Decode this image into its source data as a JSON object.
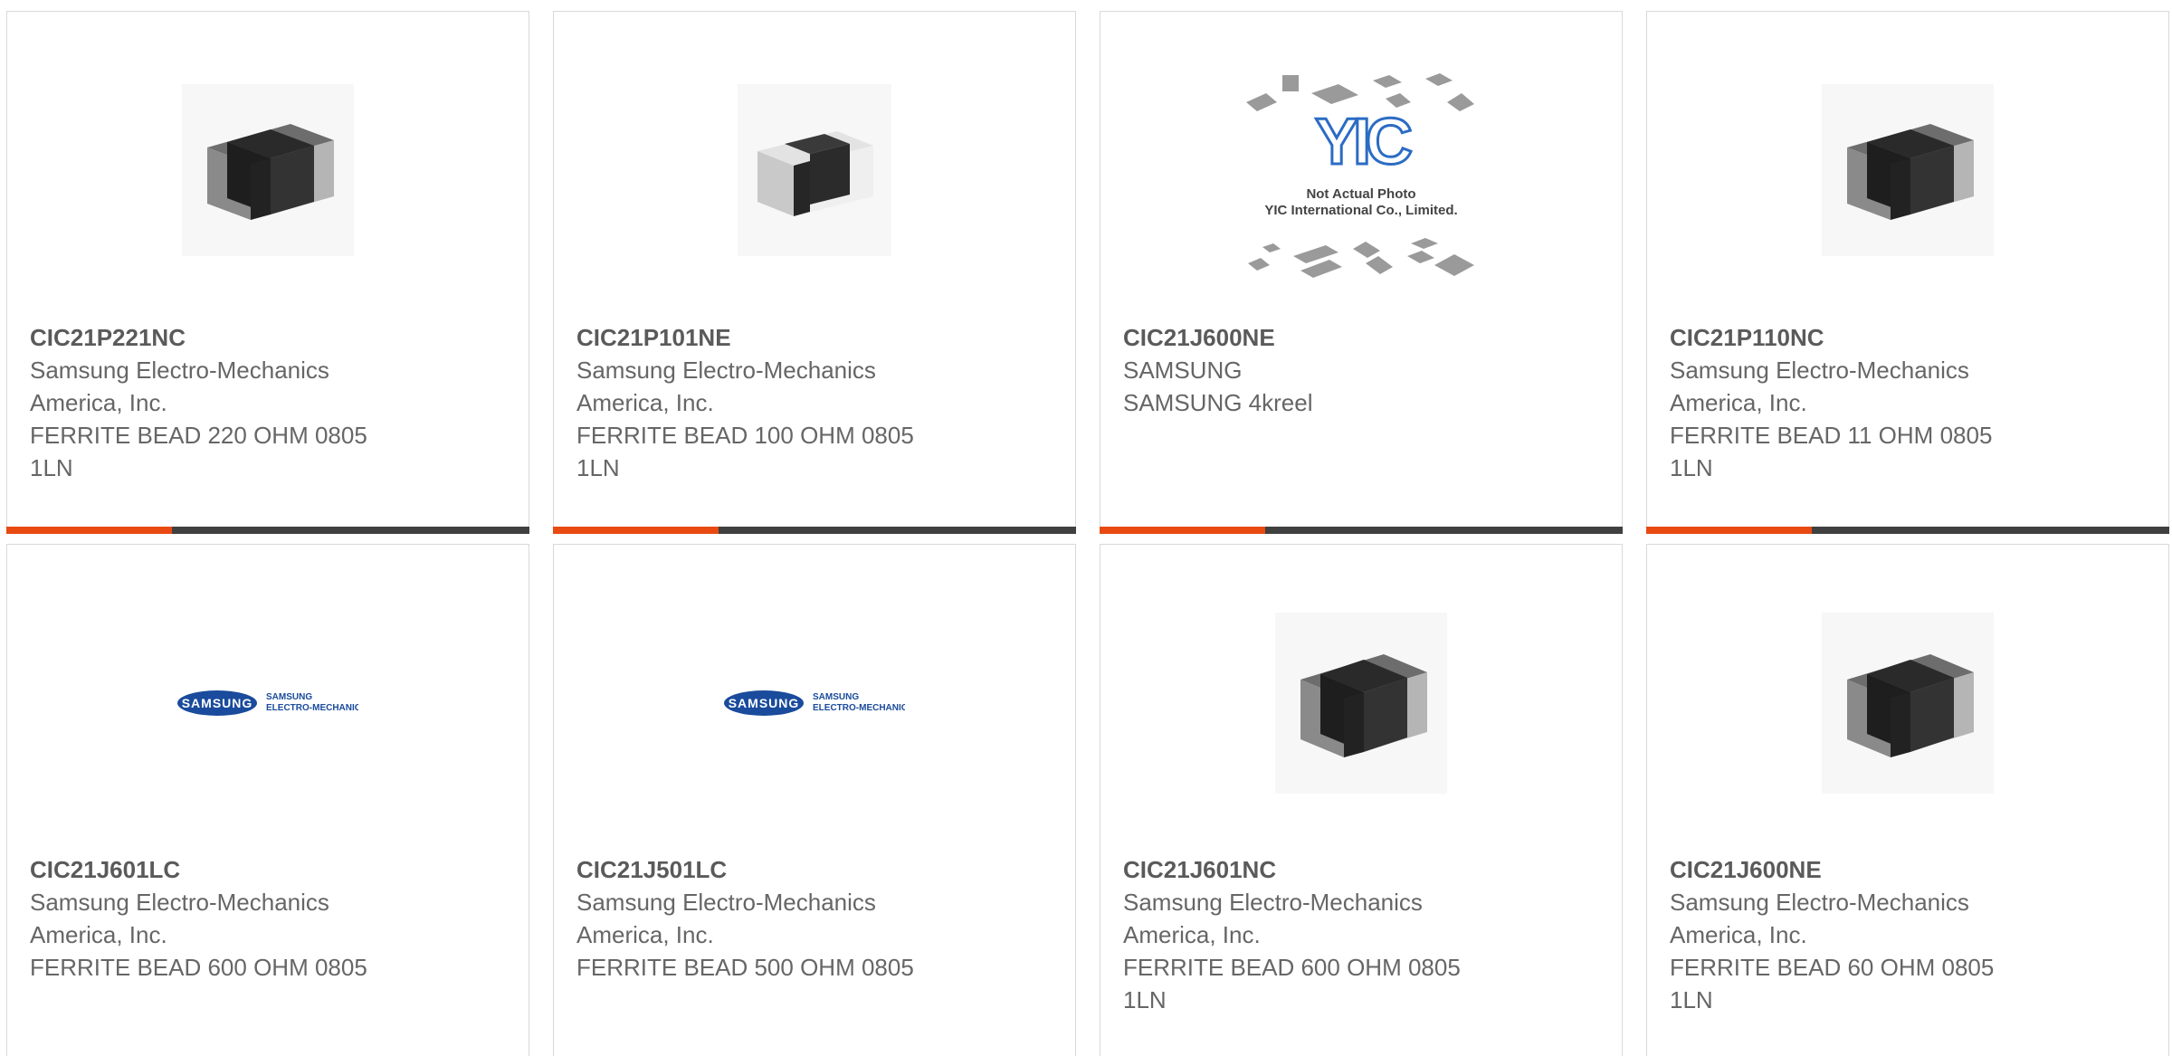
{
  "colors": {
    "accent": "#e84a12",
    "bar": "#404040",
    "text": "#666666",
    "part_number": "#5a5a5a",
    "border": "#d9d9d9",
    "samsung_blue": "#1a4b9c",
    "yic_blue": "#2b6cc4"
  },
  "products": [
    {
      "part_number": "CIC21P221NC",
      "manufacturer_line1": "Samsung Electro-Mechanics",
      "manufacturer_line2": "America, Inc.",
      "description_line1": "FERRITE BEAD 220 OHM 0805",
      "description_line2": "1LN",
      "image": "ferrite-bead-photo"
    },
    {
      "part_number": "CIC21P101NE",
      "manufacturer_line1": "Samsung Electro-Mechanics",
      "manufacturer_line2": "America, Inc.",
      "description_line1": "FERRITE BEAD 100 OHM 0805",
      "description_line2": "1LN",
      "image": "ferrite-bead-photo-light"
    },
    {
      "part_number": "CIC21J600NE",
      "manufacturer_line1": "SAMSUNG",
      "manufacturer_line2": "SAMSUNG 4kreel",
      "description_line1": "",
      "description_line2": "",
      "image": "yic-placeholder",
      "placeholder_logo": "YIC",
      "placeholder_line1": "Not Actual Photo",
      "placeholder_line2": "YIC International Co., Limited."
    },
    {
      "part_number": "CIC21P110NC",
      "manufacturer_line1": "Samsung Electro-Mechanics",
      "manufacturer_line2": "America, Inc.",
      "description_line1": "FERRITE BEAD 11 OHM 0805",
      "description_line2": "1LN",
      "image": "ferrite-bead-photo"
    },
    {
      "part_number": "CIC21J601LC",
      "manufacturer_line1": "Samsung Electro-Mechanics",
      "manufacturer_line2": "America, Inc.",
      "description_line1": "FERRITE BEAD 600 OHM 0805",
      "description_line2": "",
      "image": "samsung-logo",
      "logo_text": "SAMSUNG",
      "logo_caption_line1": "SAMSUNG",
      "logo_caption_line2": "ELECTRO-MECHANICS"
    },
    {
      "part_number": "CIC21J501LC",
      "manufacturer_line1": "Samsung Electro-Mechanics",
      "manufacturer_line2": "America, Inc.",
      "description_line1": "FERRITE BEAD 500 OHM 0805",
      "description_line2": "",
      "image": "samsung-logo",
      "logo_text": "SAMSUNG",
      "logo_caption_line1": "SAMSUNG",
      "logo_caption_line2": "ELECTRO-MECHANICS"
    },
    {
      "part_number": "CIC21J601NC",
      "manufacturer_line1": "Samsung Electro-Mechanics",
      "manufacturer_line2": "America, Inc.",
      "description_line1": "FERRITE BEAD 600 OHM 0805",
      "description_line2": "1LN",
      "image": "ferrite-bead-photo"
    },
    {
      "part_number": "CIC21J600NE",
      "manufacturer_line1": "Samsung Electro-Mechanics",
      "manufacturer_line2": "America, Inc.",
      "description_line1": "FERRITE BEAD 60 OHM 0805",
      "description_line2": "1LN",
      "image": "ferrite-bead-photo"
    }
  ]
}
